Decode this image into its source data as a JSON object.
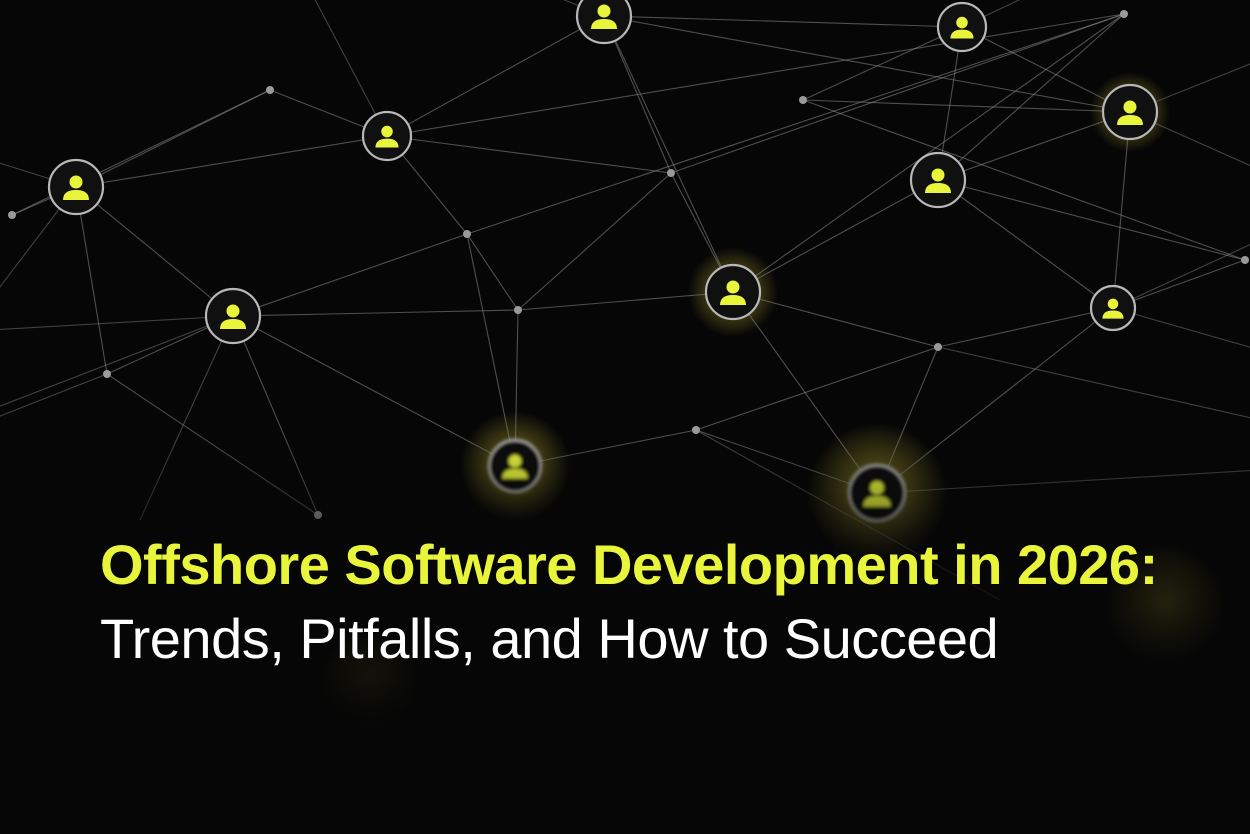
{
  "headline": {
    "highlight": "Offshore Software Development in 2026:",
    "rest": "Trends, Pitfalls, and How to Succeed"
  },
  "colors": {
    "background": "#060606",
    "accent": "#e9f53a",
    "text": "#ffffff",
    "line": "#8a8a8a"
  },
  "image": {
    "subject": "network-of-connected-user-nodes",
    "icons": [
      "user-icon"
    ]
  }
}
